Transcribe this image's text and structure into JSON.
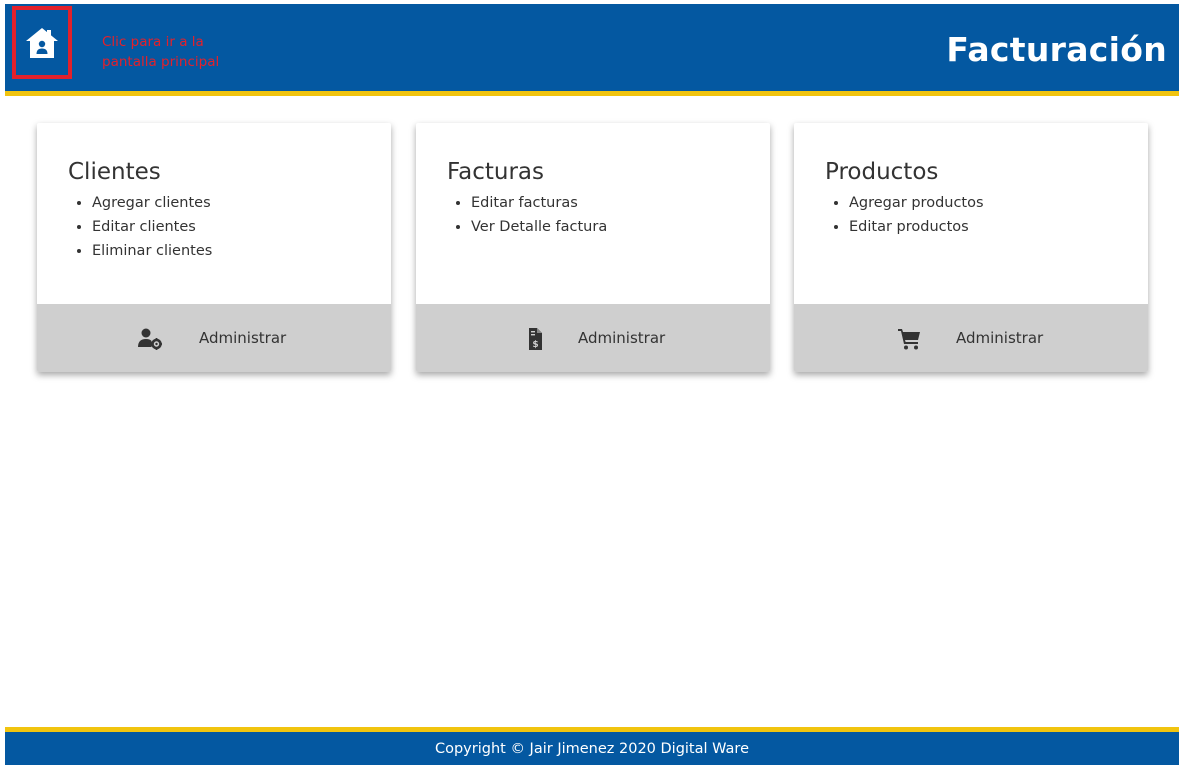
{
  "header": {
    "home_icon": "home-icon",
    "annotation": "Clic para ir a la pantalla principal",
    "title": "Facturación",
    "colors": {
      "background": "#0458a1",
      "accent": "#f1c40f",
      "annotation": "#e3212b"
    }
  },
  "cards": [
    {
      "title": "Clientes",
      "items": [
        "Agregar clientes",
        "Editar clientes",
        "Eliminar clientes"
      ],
      "icon": "user-gear-icon",
      "action_label": "Administrar"
    },
    {
      "title": "Facturas",
      "items": [
        "Editar facturas",
        "Ver Detalle factura"
      ],
      "icon": "invoice-dollar-icon",
      "action_label": "Administrar"
    },
    {
      "title": "Productos",
      "items": [
        "Agregar productos",
        "Editar productos"
      ],
      "icon": "shopping-cart-icon",
      "action_label": "Administrar"
    }
  ],
  "footer": {
    "text": "Copyright © Jair Jimenez 2020 Digital Ware"
  }
}
